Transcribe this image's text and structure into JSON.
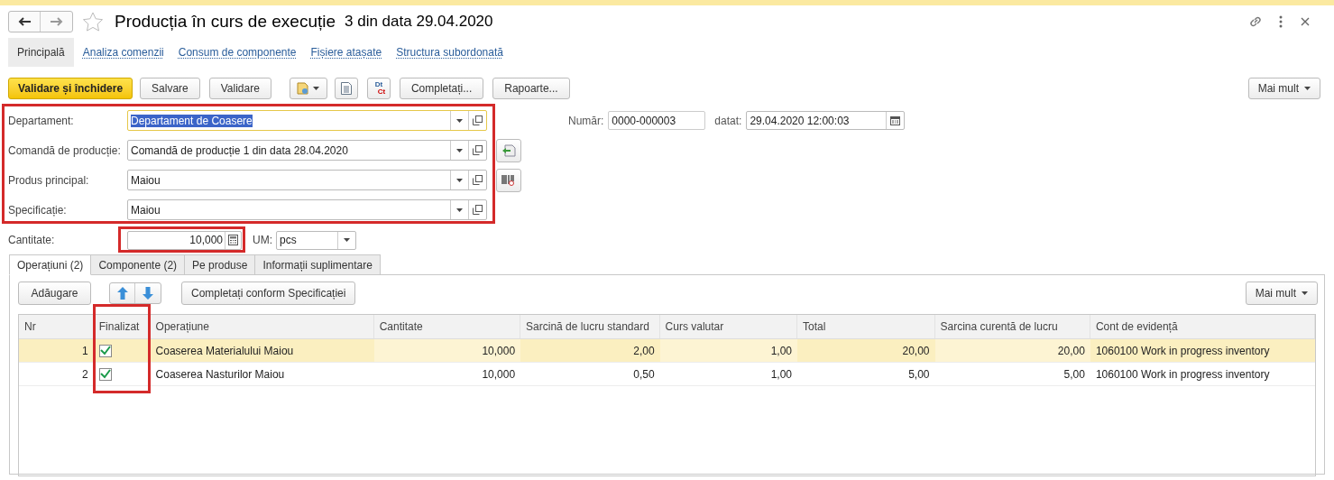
{
  "window": {
    "title": "Producția în curs de execuție",
    "subtitle": "3 din data 29.04.2020"
  },
  "nav_tabs": [
    {
      "label": "Principală",
      "selected": true
    },
    {
      "label": "Analiza comenzii",
      "selected": false
    },
    {
      "label": "Consum de componente",
      "selected": false
    },
    {
      "label": "Fișiere atașate",
      "selected": false
    },
    {
      "label": "Structura subordonată",
      "selected": false
    }
  ],
  "toolbar": [
    {
      "kind": "primary",
      "label": "Validare și închidere"
    },
    {
      "kind": "text",
      "label": "Salvare"
    },
    {
      "kind": "text",
      "label": "Validare"
    },
    {
      "kind": "menu-icon"
    },
    {
      "kind": "doc-icon"
    },
    {
      "kind": "dtct",
      "label": "Dt",
      "label2": "Ct"
    },
    {
      "kind": "text",
      "label": "Completați..."
    },
    {
      "kind": "text",
      "label": "Rapoarte..."
    }
  ],
  "more_button": "Mai mult",
  "fields": [
    {
      "label": "Departament:",
      "value": "Departament de Coasere",
      "focused": true,
      "kind": "select"
    },
    {
      "label": "Comandă de producție:",
      "value": "Comandă de producție 1 din data 28.04.2020",
      "focused": false,
      "kind": "select-fill"
    },
    {
      "label": "Produs principal:",
      "value": "Maiou",
      "focused": false,
      "kind": "select-barcode"
    },
    {
      "label": "Specificație:",
      "value": "Maiou",
      "focused": false,
      "kind": "select"
    }
  ],
  "number": {
    "label": "Număr:",
    "value": "0000-000003"
  },
  "date": {
    "label": "datat:",
    "value": "29.04.2020 12:00:03"
  },
  "quantity": {
    "label": "Cantitate:",
    "value": "10,000"
  },
  "unit": {
    "label": "UM:",
    "value": "pcs"
  },
  "tabs": [
    {
      "label": "Operațiuni (2)",
      "selected": true
    },
    {
      "label": "Componente (2)",
      "selected": false
    },
    {
      "label": "Pe produse",
      "selected": false
    },
    {
      "label": "Informații suplimentare",
      "selected": false
    }
  ],
  "table_toolbar": {
    "add": "Adăugare",
    "fill": "Completați conform Specificației",
    "more": "Mai mult"
  },
  "table": {
    "columns": [
      "Nr",
      "Finalizat",
      "Operațiune",
      "Cantitate",
      "Sarcină de lucru standard",
      "Curs valutar",
      "Total",
      "Sarcina curentă de lucru",
      "Cont de evidență"
    ],
    "rows": [
      {
        "selected": true,
        "checked": true,
        "cells": [
          "1",
          "",
          "Coaserea Materialului Maiou",
          "10,000",
          "2,00",
          "1,00",
          "20,00",
          "20,00",
          "1060100 Work in progress inventory"
        ]
      },
      {
        "selected": false,
        "checked": true,
        "cells": [
          "2",
          "",
          "Coaserea Nasturilor Maiou",
          "10,000",
          "0,50",
          "1,00",
          "5,00",
          "5,00",
          "1060100 Work in progress inventory"
        ]
      }
    ]
  }
}
